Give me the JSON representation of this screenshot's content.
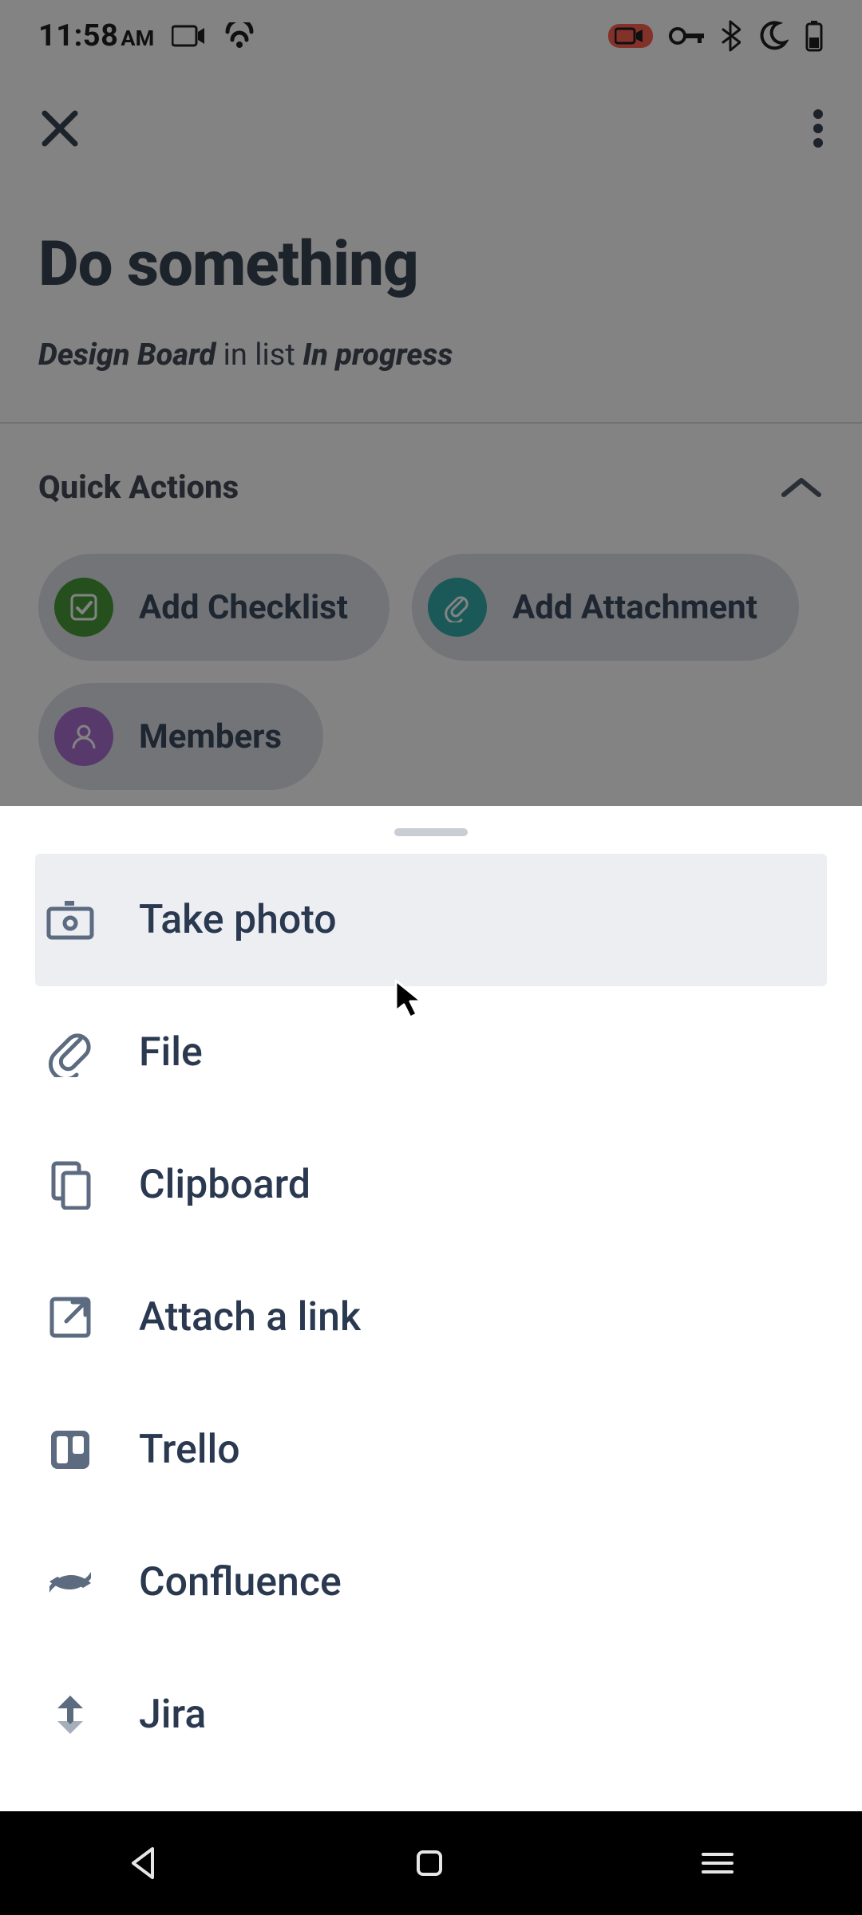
{
  "status": {
    "time": "11:58",
    "ampm": "AM"
  },
  "header": {
    "title": "Do something",
    "board": "Design Board",
    "in_list": "in list",
    "list": "In progress"
  },
  "quick_actions": {
    "title": "Quick Actions",
    "chips": [
      {
        "icon": "check",
        "color": "green",
        "label": "Add Checklist"
      },
      {
        "icon": "clip",
        "color": "teal",
        "label": "Add Attachment"
      },
      {
        "icon": "user",
        "color": "purple",
        "label": "Members"
      }
    ]
  },
  "sheet": {
    "items": [
      {
        "icon": "camera-icon",
        "label": "Take photo",
        "highlight": true
      },
      {
        "icon": "paperclip-icon",
        "label": "File",
        "highlight": false
      },
      {
        "icon": "clipboard-icon",
        "label": "Clipboard",
        "highlight": false
      },
      {
        "icon": "link-out-icon",
        "label": "Attach a link",
        "highlight": false
      },
      {
        "icon": "trello-icon",
        "label": "Trello",
        "highlight": false
      },
      {
        "icon": "confluence-icon",
        "label": "Confluence",
        "highlight": false
      },
      {
        "icon": "jira-icon",
        "label": "Jira",
        "highlight": false
      }
    ]
  }
}
